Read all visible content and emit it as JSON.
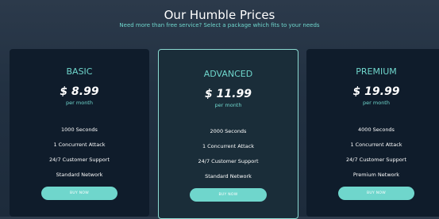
{
  "header": {
    "title": "Our Humble Prices",
    "subtitle": "Need more than free service? Select a package which fits to your needs"
  },
  "plans": [
    {
      "name": "BASIC",
      "price": "$ 8.99",
      "period": "per month",
      "features": [
        "1000 Seconds",
        "1 Concurrent Attack",
        "24/7 Customer Support",
        "Standard Network"
      ],
      "button_label": "BUY NOW"
    },
    {
      "name": "ADVANCED",
      "price": "$ 11.99",
      "period": "per month",
      "features": [
        "2000 Seconds",
        "1 Concurrent Attack",
        "24/7 Customer Support",
        "Standard Network"
      ],
      "button_label": "BUY NOW",
      "highlighted": true
    },
    {
      "name": "PREMIUM",
      "price": "$ 19.99",
      "period": "per month",
      "features": [
        "4000 Seconds",
        "1 Concurrent Attack",
        "24/7 Customer Support",
        "Premium Network"
      ],
      "button_label": "BUY NOW"
    }
  ],
  "colors": {
    "accent": "#6fd6cc",
    "card_bg": "#0f1c2b",
    "highlight_card_bg": "#1a2d39",
    "page_bg": "#223142"
  }
}
